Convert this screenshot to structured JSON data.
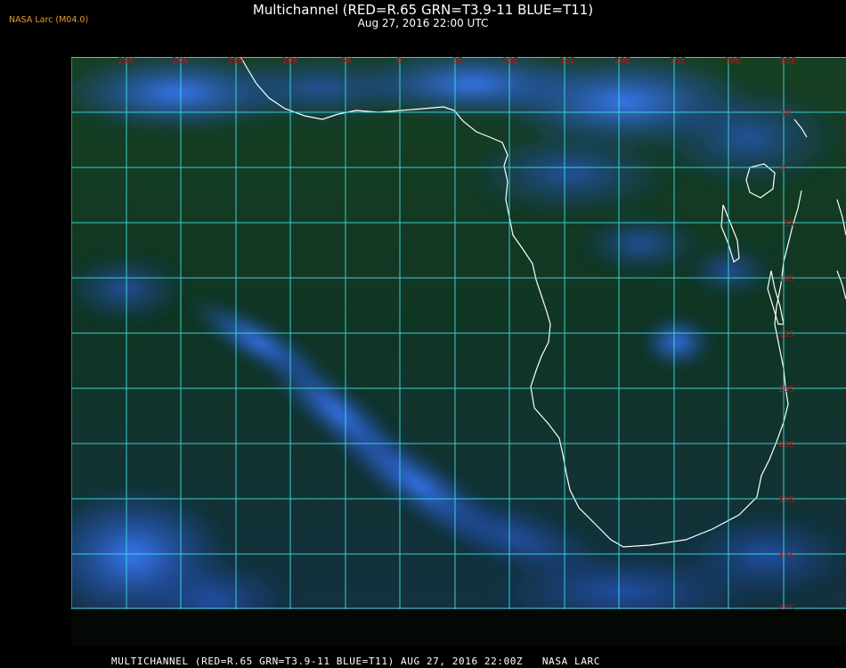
{
  "header": {
    "title": "Multichannel (RED=R.65 GRN=T3.9-11 BLUE=T11)",
    "datetime": "Aug 27, 2016 22:00 UTC",
    "org": "NASA Larc (M04.0)"
  },
  "footer": {
    "text": "MULTICHANNEL (RED=R.65 GRN=T3.9-11 BLUE=T11) AUG 27, 2016 22:00Z   NASA LARC"
  },
  "map": {
    "longitude_labels": [
      "25W",
      "20W",
      "15W",
      "10W",
      "5W",
      "0",
      "5E",
      "10E",
      "15E",
      "20E",
      "25E",
      "30E",
      "35E"
    ],
    "latitude_labels": [
      "5N",
      "0",
      "5S",
      "10S",
      "15S",
      "20S",
      "25S",
      "30S",
      "35S",
      "40S"
    ],
    "colors": {
      "grid": "#3fe0e0",
      "coastline": "#ffffff",
      "grid_label": "#b01818",
      "cloud": "#2f6cf0",
      "ocean_land": "#0d2a18"
    }
  }
}
